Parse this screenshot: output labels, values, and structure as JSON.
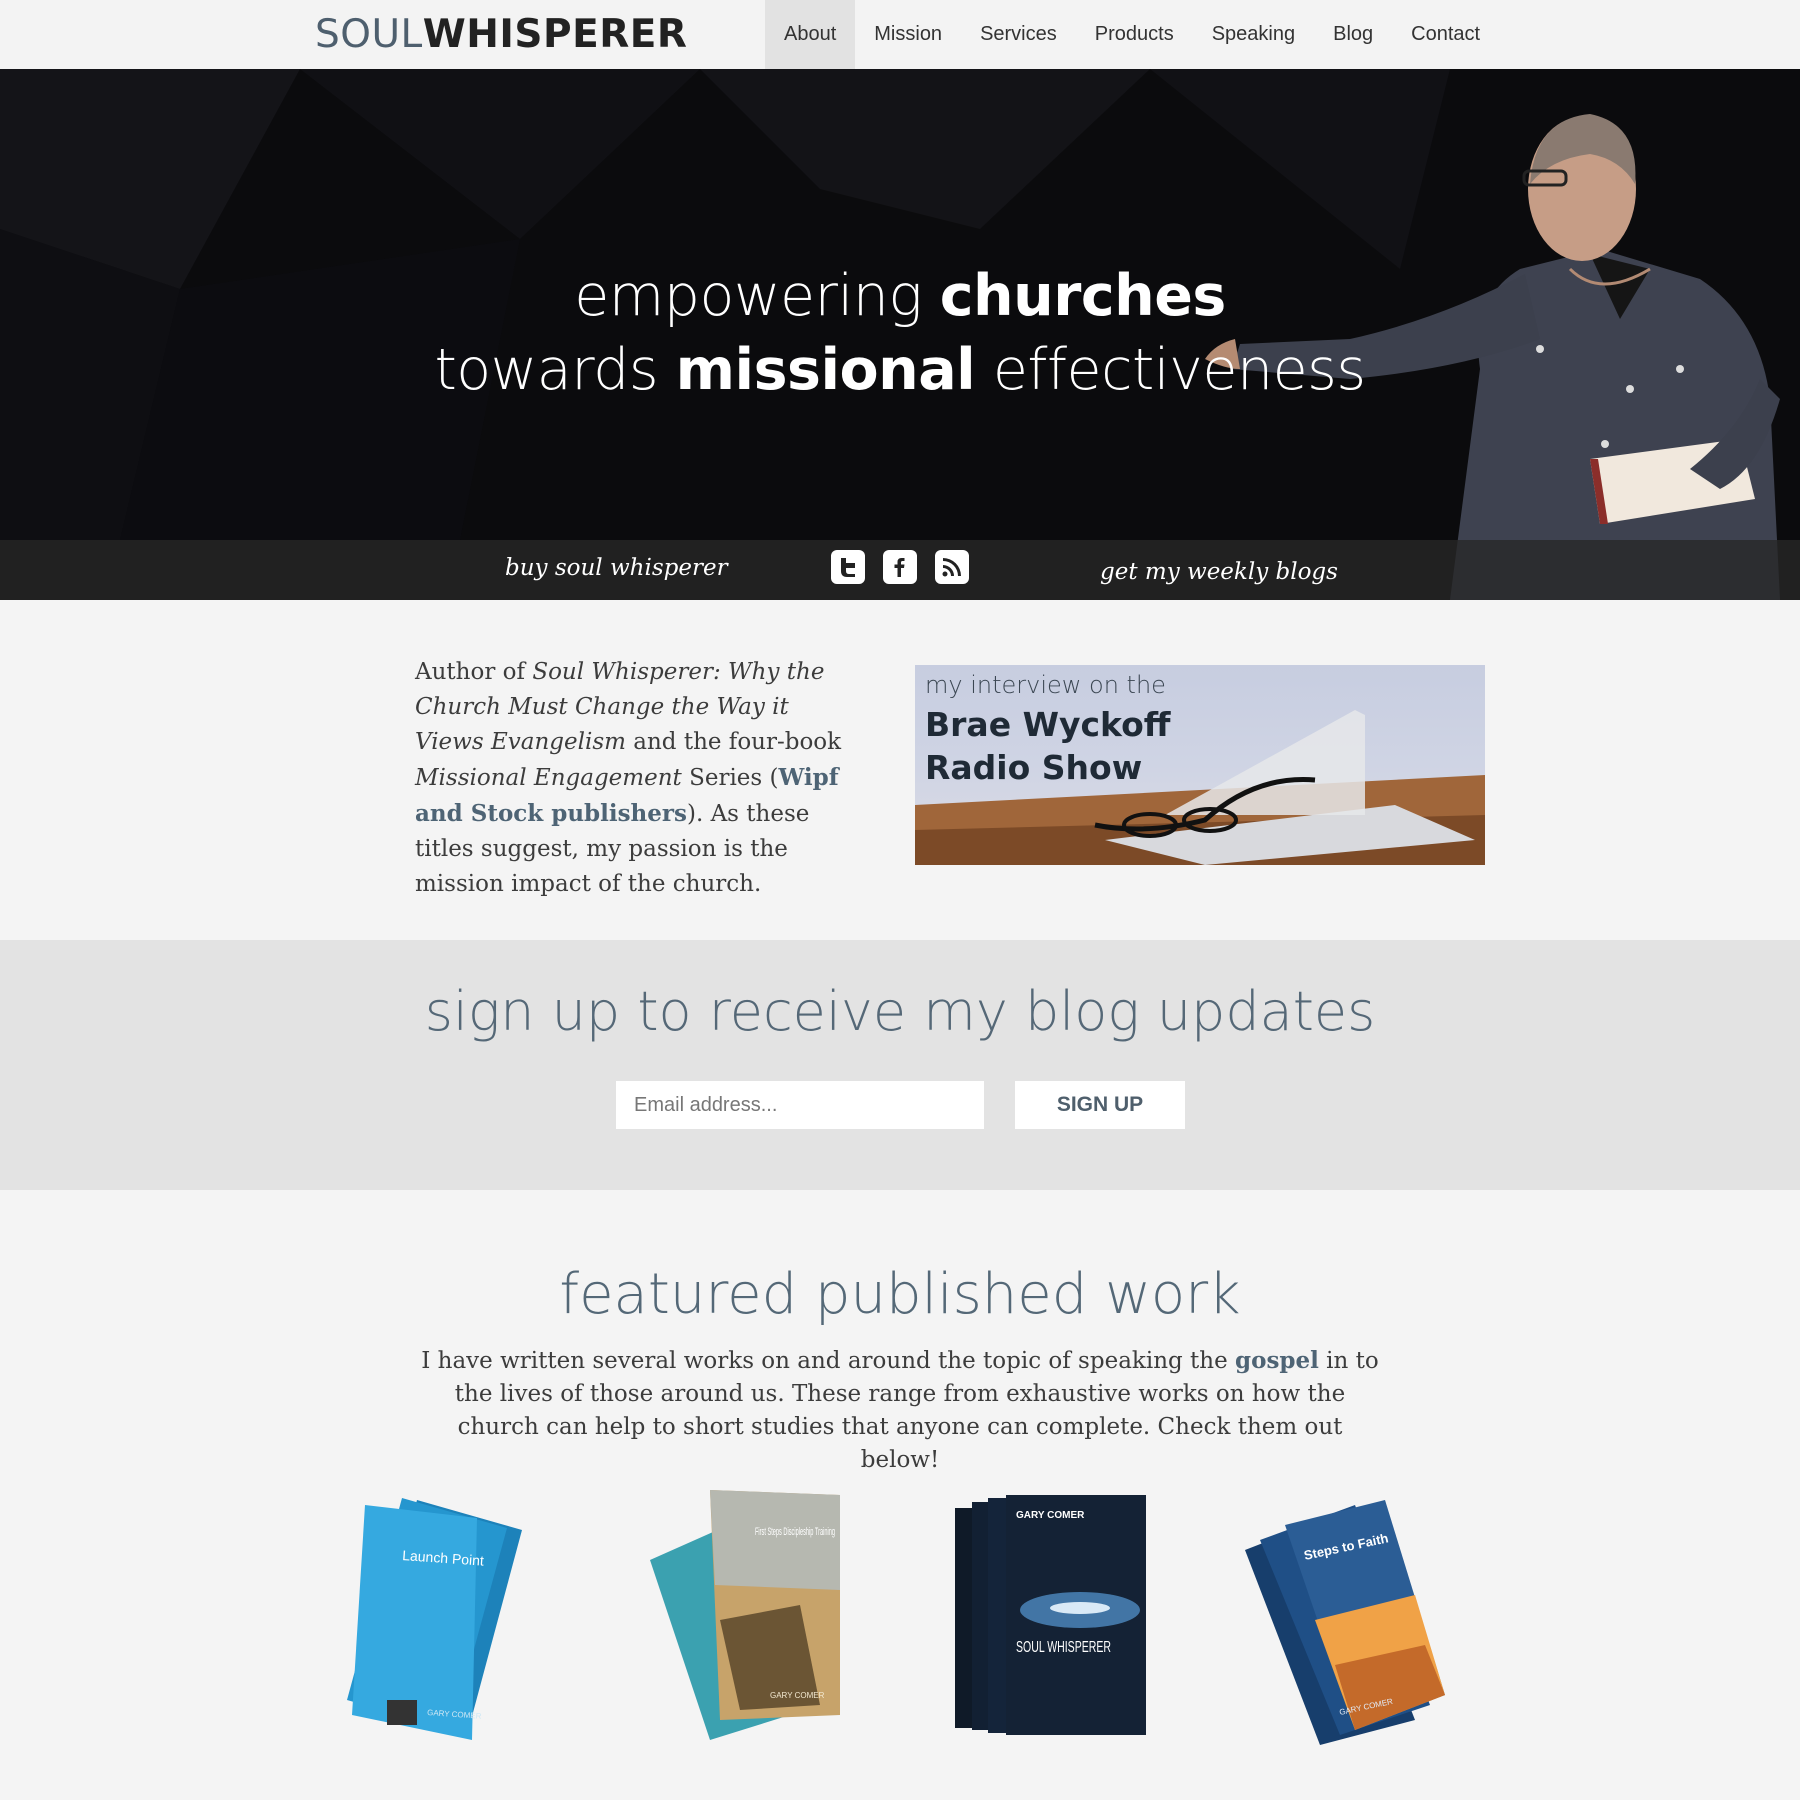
{
  "logo": {
    "soul": "SOUL",
    "whisperer": "WHISPERER"
  },
  "nav": {
    "items": [
      {
        "label": "About",
        "active": true
      },
      {
        "label": "Mission"
      },
      {
        "label": "Services"
      },
      {
        "label": "Products"
      },
      {
        "label": "Speaking"
      },
      {
        "label": "Blog"
      },
      {
        "label": "Contact"
      }
    ]
  },
  "hero": {
    "line1_pre": "empowering ",
    "line1_bold": "churches",
    "line2_pre": "towards ",
    "line2_bold": "missional",
    "line2_post": " effectiveness",
    "buy_link": "buy soul whisperer",
    "blogs_link": "get my weekly blogs",
    "social_icons": [
      "twitter-icon",
      "facebook-icon",
      "rss-icon"
    ]
  },
  "intro": {
    "t1": "Author of ",
    "t2": "Soul Whisperer: Why the Church Must Change the Way it Views Evangelism",
    "t3": " and the four-book ",
    "t4": "Missional Engagement",
    "t5": " Series (",
    "link": "Wipf and Stock publishers",
    "t6": "). As these titles suggest, my passion is the mission impact of the church."
  },
  "radio": {
    "pre": "my interview on the",
    "name": "Brae Wyckoff Radio Show"
  },
  "signup": {
    "title": "sign up to receive my blog updates",
    "placeholder": "Email address...",
    "button": "SIGN UP"
  },
  "featured": {
    "title": "featured published work",
    "t1": "I have written several works on and around the topic of speaking the ",
    "link": "gospel",
    "t2": " in to the lives of those around us. These range from exhaustive works on how the church can help to short studies that anyone can complete. Check them out below!"
  },
  "books": [
    {
      "title": "Launch Point",
      "author": "GARY COMER",
      "color": "#2f9fd6"
    },
    {
      "title": "First Steps Discipleship Training",
      "author": "GARY COMER",
      "color": "#7a6a4a"
    },
    {
      "title": "SOUL WHISPERER",
      "author": "GARY COMER",
      "color": "#142235"
    },
    {
      "title": "Steps to Faith",
      "author": "GARY COMER",
      "color": "#2b5d95"
    }
  ],
  "colors": {
    "accent": "#4e6475",
    "nav_bg": "#f3f3f3",
    "signup_bg": "#e3e3e3"
  }
}
